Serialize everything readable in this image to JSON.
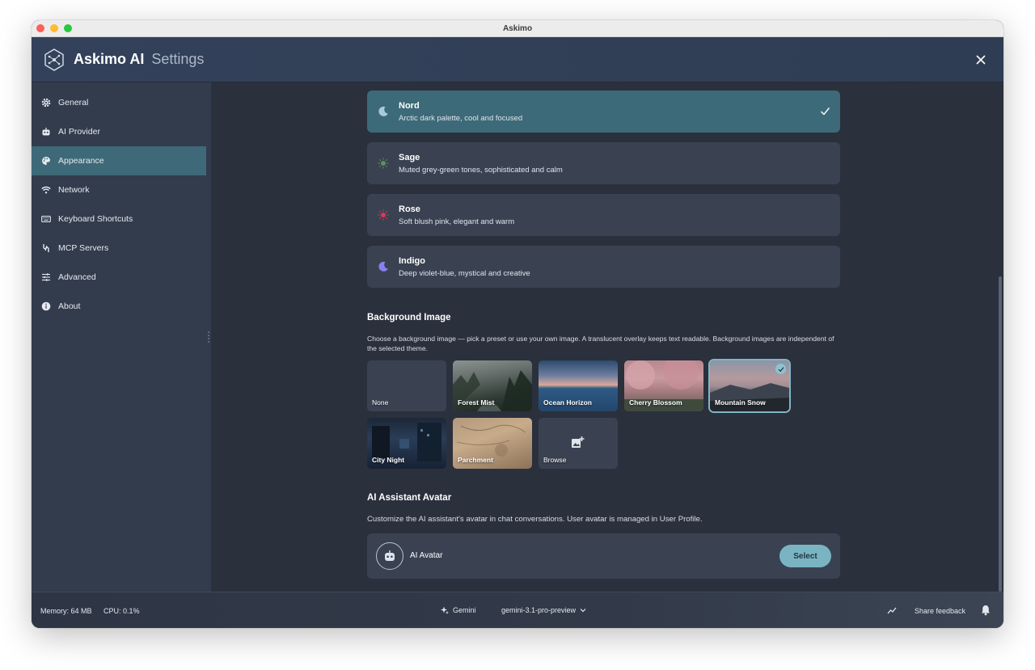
{
  "window": {
    "title": "Askimo"
  },
  "header": {
    "brand": "Askimo AI",
    "subtitle": "Settings"
  },
  "sidebar": {
    "items": [
      {
        "label": "General",
        "icon": "gear-icon"
      },
      {
        "label": "AI Provider",
        "icon": "robot-icon"
      },
      {
        "label": "Appearance",
        "icon": "palette-icon",
        "active": true
      },
      {
        "label": "Network",
        "icon": "wifi-icon"
      },
      {
        "label": "Keyboard Shortcuts",
        "icon": "keyboard-icon"
      },
      {
        "label": "MCP Servers",
        "icon": "plug-icon"
      },
      {
        "label": "Advanced",
        "icon": "sliders-icon"
      },
      {
        "label": "About",
        "icon": "info-icon"
      }
    ]
  },
  "themes": [
    {
      "name": "Nord",
      "desc": "Arctic dark palette, cool and focused",
      "icon": "moon-icon",
      "color": "#a9cbd8",
      "selected": true
    },
    {
      "name": "Sage",
      "desc": "Muted grey-green tones, sophisticated and calm",
      "icon": "sun-icon",
      "color": "#5f8f5a"
    },
    {
      "name": "Rose",
      "desc": "Soft blush pink, elegant and warm",
      "icon": "sun-icon",
      "color": "#d93a55"
    },
    {
      "name": "Indigo",
      "desc": "Deep violet-blue, mystical and creative",
      "icon": "moon-icon",
      "color": "#8a7ff0"
    }
  ],
  "background": {
    "title": "Background Image",
    "desc": "Choose a background image — pick a preset or use your own image. A translucent overlay keeps text readable. Background images are independent of the selected theme.",
    "tiles": [
      {
        "label": "None"
      },
      {
        "label": "Forest Mist"
      },
      {
        "label": "Ocean Horizon"
      },
      {
        "label": "Cherry Blossom"
      },
      {
        "label": "Mountain Snow",
        "selected": true
      },
      {
        "label": "City Night"
      },
      {
        "label": "Parchment"
      },
      {
        "label": "Browse"
      }
    ]
  },
  "avatar": {
    "title": "AI Assistant Avatar",
    "desc": "Customize the AI assistant's avatar in chat conversations. User avatar is managed in User Profile.",
    "label": "AI Avatar",
    "button": "Select"
  },
  "status": {
    "memory": "Memory: 64 MB",
    "cpu": "CPU: 0.1%",
    "provider": "Gemini",
    "model": "gemini-3.1-pro-preview",
    "feedback": "Share feedback"
  },
  "colors": {
    "accent": "#3e6978",
    "button": "#7ab4c3"
  }
}
